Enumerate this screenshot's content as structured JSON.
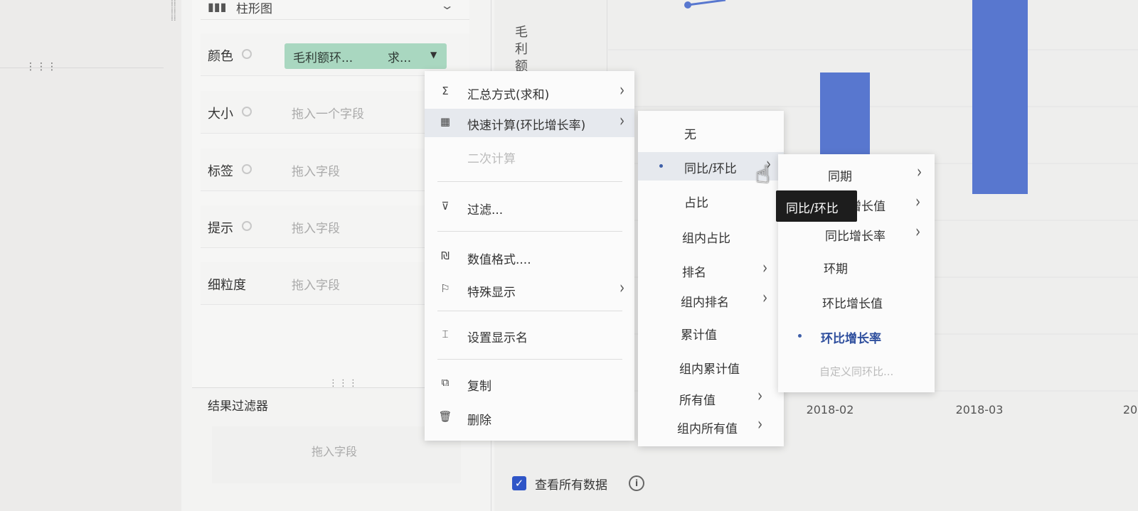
{
  "marks": {
    "chart_type": "柱形图",
    "properties": [
      {
        "label": "颜色",
        "placeholder": ""
      },
      {
        "label": "大小",
        "placeholder": "拖入一个字段"
      },
      {
        "label": "标签",
        "placeholder": "拖入字段"
      },
      {
        "label": "提示",
        "placeholder": "拖入字段"
      },
      {
        "label": "细粒度",
        "placeholder": "拖入字段"
      }
    ],
    "color_pill": {
      "label": "毛利额环...",
      "agg": "求...",
      "caret": "▼"
    }
  },
  "result_filter": {
    "title": "结果过滤器",
    "placeholder": "拖入字段"
  },
  "chart": {
    "y_axis_label": "毛利额",
    "view_all_label": "查看所有数据",
    "accent_bar_color": "#5877cf"
  },
  "chart_data": {
    "type": "bar",
    "categories": [
      "2018-02",
      "2018-03",
      "20"
    ],
    "ylabel": "毛利额"
  },
  "context_menu": {
    "items": [
      {
        "label": "汇总方式(求和)",
        "icon": "sigma-icon",
        "submenu": true
      },
      {
        "label": "快速计算(环比增长率)",
        "icon": "calculator-icon",
        "submenu": true,
        "highlighted": true
      },
      {
        "label": "二次计算",
        "disabled": true
      },
      {
        "label": "过滤...",
        "icon": "filter-icon"
      },
      {
        "label": "数值格式....",
        "icon": "number-format-icon"
      },
      {
        "label": "特殊显示",
        "icon": "flag-icon",
        "submenu": true
      },
      {
        "label": "设置显示名",
        "icon": "rename-icon"
      },
      {
        "label": "复制",
        "icon": "copy-icon"
      },
      {
        "label": "删除",
        "icon": "delete-icon"
      }
    ]
  },
  "quick_calc_menu": {
    "items": [
      {
        "label": "无"
      },
      {
        "label": "同比/环比",
        "selected": true,
        "submenu": true,
        "highlighted": true
      },
      {
        "label": "占比"
      },
      {
        "label": "组内占比"
      },
      {
        "label": "排名",
        "submenu": true
      },
      {
        "label": "组内排名",
        "submenu": true
      },
      {
        "label": "累计值"
      },
      {
        "label": "组内累计值"
      },
      {
        "label": "所有值",
        "submenu": true
      },
      {
        "label": "组内所有值",
        "submenu": true
      }
    ]
  },
  "yoy_menu": {
    "items": [
      {
        "label": "同期",
        "submenu": true
      },
      {
        "label": "同比增长值",
        "submenu": true
      },
      {
        "label": "同比增长率",
        "submenu": true
      },
      {
        "label": "环期"
      },
      {
        "label": "环比增长值"
      },
      {
        "label": "环比增长率",
        "selected": true
      },
      {
        "label": "自定义同环比...",
        "disabled": true
      }
    ]
  },
  "tooltip": {
    "text": "同比/环比"
  }
}
